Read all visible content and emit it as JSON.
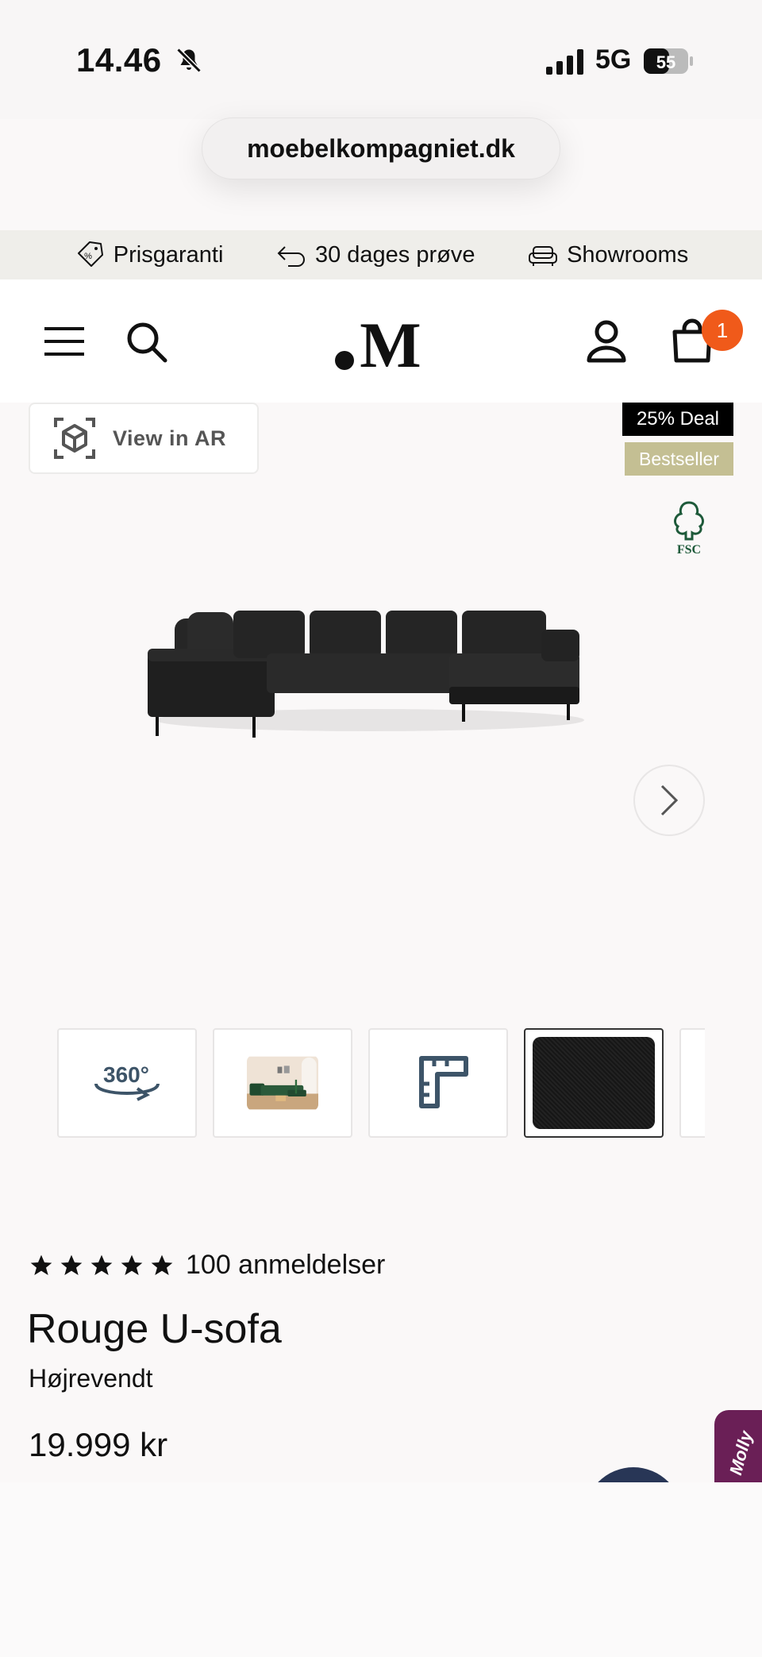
{
  "status_bar": {
    "time": "14.46",
    "network": "5G",
    "battery": "55"
  },
  "browser": {
    "url": "moebelkompagniet.dk"
  },
  "promo": [
    {
      "icon": "price-tag-icon",
      "label": "Prisgaranti"
    },
    {
      "icon": "return-arrow-icon",
      "label": "30 dages prøve"
    },
    {
      "icon": "sofa-icon",
      "label": "Showrooms"
    }
  ],
  "header": {
    "logo": "M",
    "cart_count": "1"
  },
  "gallery": {
    "ar_label": "View in AR",
    "deal_badge": "25% Deal",
    "bestseller_badge": "Bestseller",
    "fsc_label": "FSC",
    "thumbnails": [
      "360-view-icon",
      "room-photo",
      "dimensions-ruler-icon",
      "fabric-swatch",
      "more"
    ],
    "thumb_360_label": "360°"
  },
  "product": {
    "rating": 5,
    "reviews": "100 anmeldelser",
    "title": "Rouge U-sofa",
    "subtitle": "Højrevendt",
    "price": "19.999 kr"
  },
  "chat": {
    "molly_label": "Molly"
  },
  "colors": {
    "accent_badge": "#f05a1a",
    "deal": "#000000",
    "bestseller": "#c4bf93",
    "molly": "#6a1f56",
    "fsc": "#1e5a3a"
  }
}
